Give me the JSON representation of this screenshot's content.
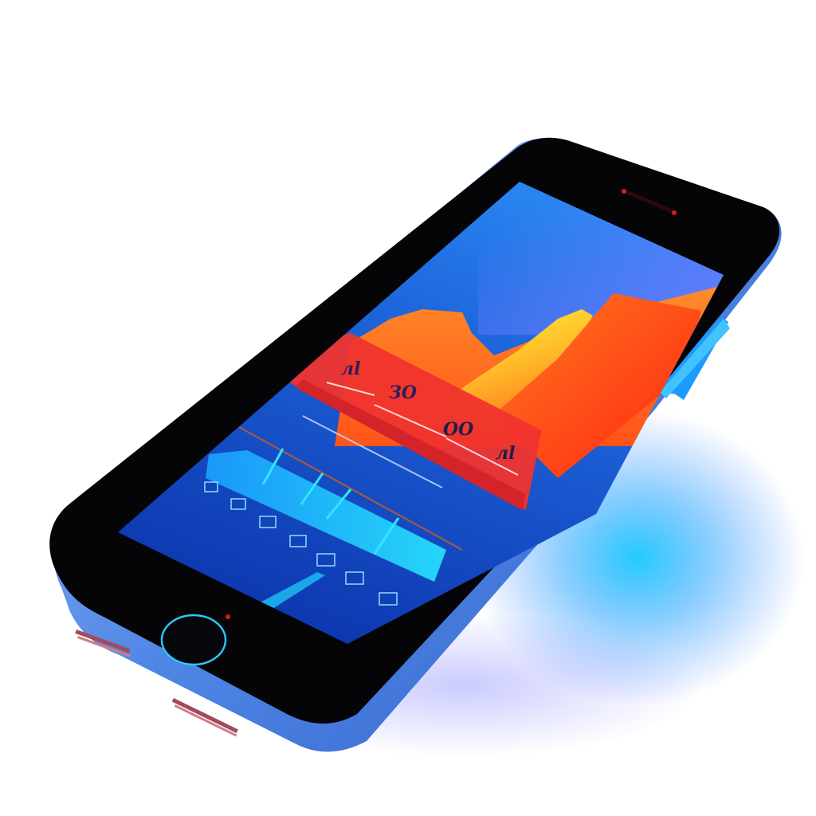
{
  "scene": {
    "subject": "smartphone",
    "screen_labels": [
      "лl",
      "ЗО",
      "ОО",
      "лl"
    ],
    "colors": {
      "body_frame": "#5b8fe6",
      "bezel": "#050507",
      "screen_top": "#1e63d8",
      "screen_bottom": "#0b2fa8",
      "band": "#f0342e",
      "area_orange": "#ff6a1c",
      "area_yellow": "#ffd22a",
      "area_red": "#ff3a14",
      "accent_cyan": "#20d8ff",
      "speaker_dot": "#e0191c",
      "glow": "#22c7ff"
    },
    "icons": [
      "home-button-icon",
      "speaker-icon",
      "side-button-icon"
    ]
  }
}
